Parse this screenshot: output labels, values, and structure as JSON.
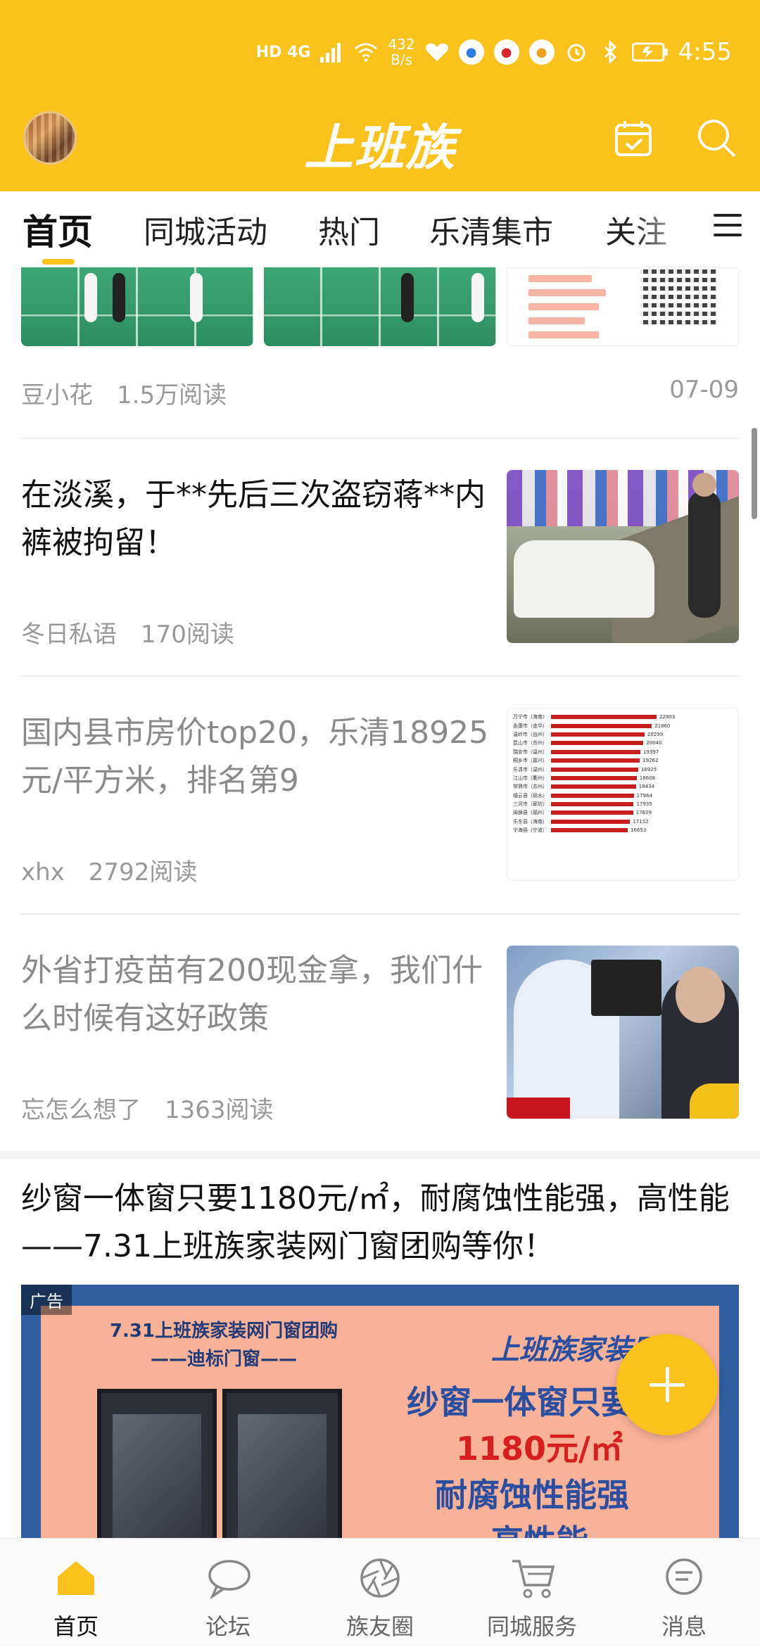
{
  "status_bar": {
    "network": "HD 4G",
    "speed_value": "432",
    "speed_unit": "B/s",
    "time": "4:55"
  },
  "app_bar": {
    "logo_text": "上班族"
  },
  "tabs": [
    {
      "label": "首页",
      "active": true
    },
    {
      "label": "同城活动",
      "active": false
    },
    {
      "label": "热门",
      "active": false
    },
    {
      "label": "乐清集市",
      "active": false
    },
    {
      "label": "关注",
      "active": false
    }
  ],
  "feed": {
    "top_item": {
      "author": "豆小花",
      "reads": "1.5万阅读",
      "date": "07-09"
    },
    "items": [
      {
        "title": "在淡溪，于**先后三次盗窃蒋**内裤被拘留！",
        "author": "冬日私语",
        "reads": "170阅读",
        "read": false
      },
      {
        "title": "国内县市房价top20，乐清18925元/平方米，排名第9",
        "author": "xhx",
        "reads": "2792阅读",
        "read": true
      },
      {
        "title": "外省打疫苗有200现金拿，我们什么时候有这好政策",
        "author": "忘怎么想了",
        "reads": "1363阅读",
        "read": true
      }
    ],
    "chart_rows": [
      {
        "label": "万宁市（海南）",
        "value": 22903
      },
      {
        "label": "永康市（金华）",
        "value": 21860
      },
      {
        "label": "温岭市（台州）",
        "value": 20299
      },
      {
        "label": "昆山市（苏州）",
        "value": 20040
      },
      {
        "label": "瑞安市（温州）",
        "value": 19397
      },
      {
        "label": "桐乡市（嘉兴）",
        "value": 19262
      },
      {
        "label": "乐清市（温州）",
        "value": 18925
      },
      {
        "label": "江山市（衢州）",
        "value": 18608
      },
      {
        "label": "常熟市（苏州）",
        "value": 18434
      },
      {
        "label": "缙云县（丽水）",
        "value": 17964
      },
      {
        "label": "三河市（廊坊）",
        "value": 17935
      },
      {
        "label": "闽侯县（福州）",
        "value": 17829
      },
      {
        "label": "乐东县（海南）",
        "value": 17152
      },
      {
        "label": "宁海县（宁波）",
        "value": 16653
      }
    ],
    "ad": {
      "title": "纱窗一体窗只要1180元/㎡，耐腐蚀性能强，高性能——7.31上班族家装网门窗团购等你！",
      "label": "广告",
      "left_title_1": "7.31上班族家装网门窗团购",
      "left_title_2": "——迪标门窗——",
      "brand": "上班族家装网",
      "line_1": "纱窗一体窗只要",
      "line_2": "1180元/㎡",
      "line_3": "耐腐蚀性能强",
      "line_4": "高性能",
      "line_color_dark": "#2a4ea0",
      "line_color_red": "#d81e1e"
    }
  },
  "bottom_nav": [
    {
      "label": "首页",
      "icon": "home-icon",
      "active": true
    },
    {
      "label": "论坛",
      "icon": "chat-bubble-icon",
      "active": false
    },
    {
      "label": "族友圈",
      "icon": "aperture-icon",
      "active": false
    },
    {
      "label": "同城服务",
      "icon": "cart-icon",
      "active": false
    },
    {
      "label": "消息",
      "icon": "message-icon",
      "active": false
    }
  ],
  "colors": {
    "brand": "#fbc21c"
  }
}
